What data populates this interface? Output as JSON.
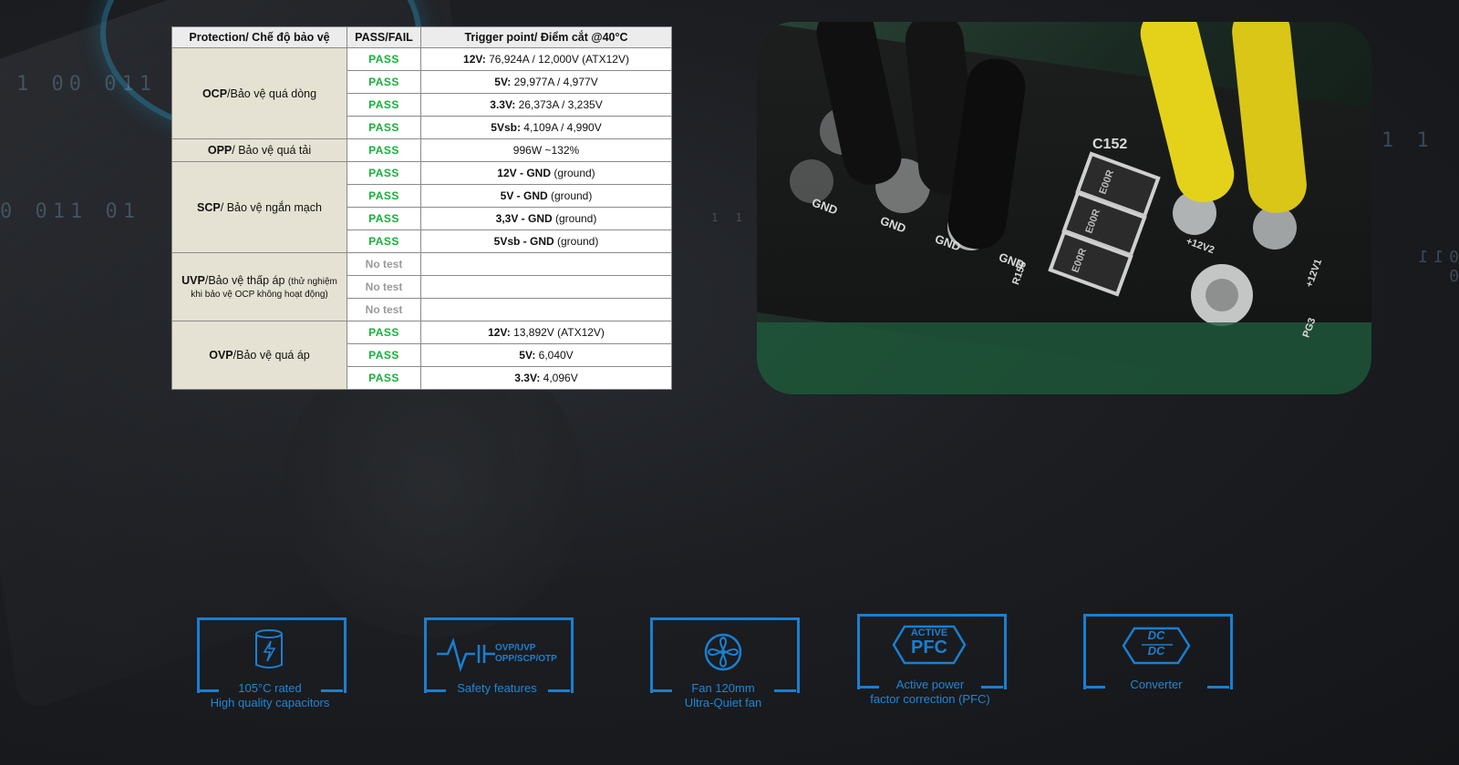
{
  "background": {
    "digits": [
      "1  00  011",
      "0  011  01",
      "1  1",
      "011  0",
      "1  1"
    ]
  },
  "table": {
    "headers": [
      "Protection/ Chế độ bảo vệ",
      "PASS/FAIL",
      "Trigger point/ Điểm cắt @40°C"
    ],
    "groups": [
      {
        "name_b": "OCP",
        "name": "/Bảo vệ quá dòng",
        "rows": [
          {
            "status": "PASS",
            "tp_b": "12V:",
            "tp": " 76,924A / 12,000V (ATX12V)"
          },
          {
            "status": "PASS",
            "tp_b": "5V:",
            "tp": " 29,977A / 4,977V"
          },
          {
            "status": "PASS",
            "tp_b": "3.3V:",
            "tp": " 26,373A / 3,235V"
          },
          {
            "status": "PASS",
            "tp_b": "5Vsb:",
            "tp": " 4,109A / 4,990V"
          }
        ]
      },
      {
        "name_b": "OPP",
        "name": "/ Bảo vệ quá tải",
        "rows": [
          {
            "status": "PASS",
            "tp_b": "",
            "tp": "996W ~132%"
          }
        ]
      },
      {
        "name_b": "SCP",
        "name": "/ Bảo vệ ngắn mạch",
        "rows": [
          {
            "status": "PASS",
            "tp_b": "12V - GND",
            "tp": " (ground)"
          },
          {
            "status": "PASS",
            "tp_b": "5V - GND",
            "tp": " (ground)"
          },
          {
            "status": "PASS",
            "tp_b": "3,3V - GND",
            "tp": " (ground)"
          },
          {
            "status": "PASS",
            "tp_b": "5Vsb - GND",
            "tp": " (ground)"
          }
        ]
      },
      {
        "name_b": "UVP",
        "name": "/Bảo vệ thấp áp",
        "note": "(thử nghiệm khi bảo vệ OCP không hoạt động)",
        "rows": [
          {
            "status": "No test",
            "tp_b": "",
            "tp": ""
          },
          {
            "status": "No test",
            "tp_b": "",
            "tp": ""
          },
          {
            "status": "No test",
            "tp_b": "",
            "tp": ""
          }
        ]
      },
      {
        "name_b": "OVP",
        "name": "/Bảo vệ quá áp",
        "rows": [
          {
            "status": "PASS",
            "tp_b": "12V:",
            "tp": " 13,892V (ATX12V)"
          },
          {
            "status": "PASS",
            "tp_b": "5V:",
            "tp": " 6,040V"
          },
          {
            "status": "PASS",
            "tp_b": "3.3V:",
            "tp": " 4,096V"
          }
        ]
      }
    ]
  },
  "photo": {
    "labels": [
      "C152",
      "GND",
      "GND",
      "GND",
      "GND",
      "R155",
      "+12V2",
      "+12V1",
      "PG3",
      "E00R",
      "E00R",
      "E00R"
    ]
  },
  "features": [
    {
      "icon": "capacitor-icon",
      "line1": "105°C rated",
      "line2": "High quality capacitors"
    },
    {
      "icon": "safety-icon",
      "icon_text": "OVP/UVP OPP/SCP/OTP",
      "line1": "Safety features",
      "line2": ""
    },
    {
      "icon": "fan-icon",
      "line1": "Fan 120mm",
      "line2": "Ultra-Quiet fan"
    },
    {
      "icon": "pfc-icon",
      "icon_text1": "ACTIVE",
      "icon_text2": "PFC",
      "line1": "Active power",
      "line2": "factor correction (PFC)"
    },
    {
      "icon": "dcdc-icon",
      "icon_text1": "DC",
      "icon_text2": "DC",
      "line1": "Converter",
      "line2": ""
    }
  ],
  "colors": {
    "accent": "#1a7fd0",
    "pass": "#16b03a",
    "group_bg": "#e6e2d3"
  }
}
